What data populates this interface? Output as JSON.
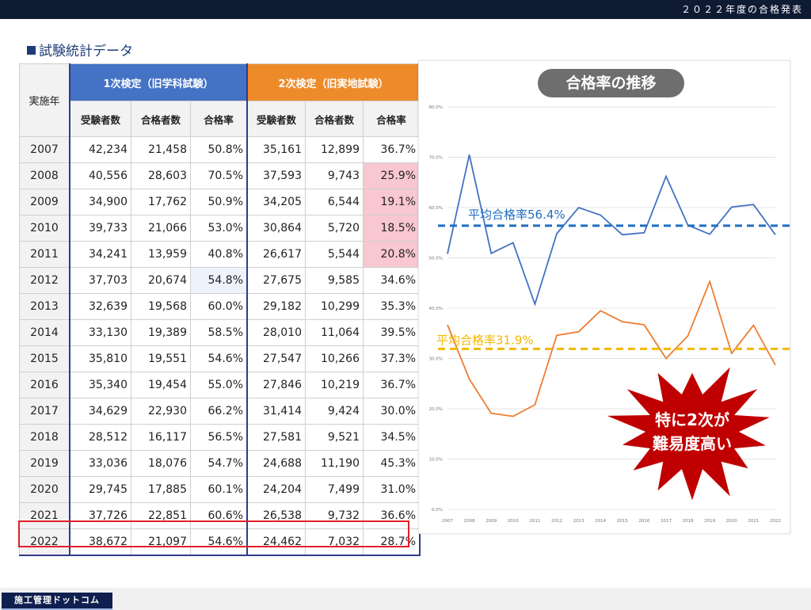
{
  "header": {
    "title": "２０２２年度の合格発表"
  },
  "section": {
    "title": "試験統計データ"
  },
  "table": {
    "year_header": "実施年",
    "group1": "1次検定（旧学科試験）",
    "group2": "2次検定（旧実地試験）",
    "sub_headers": [
      "受験者数",
      "合格者数",
      "合格率",
      "受験者数",
      "合格者数",
      "合格率"
    ],
    "rows": [
      {
        "year": "2007",
        "c1": "42,234",
        "c2": "21,458",
        "c3": "50.8%",
        "c4": "35,161",
        "c5": "12,899",
        "c6": "36.7%"
      },
      {
        "year": "2008",
        "c1": "40,556",
        "c2": "28,603",
        "c3": "70.5%",
        "c4": "37,593",
        "c5": "9,743",
        "c6": "25.9%"
      },
      {
        "year": "2009",
        "c1": "34,900",
        "c2": "17,762",
        "c3": "50.9%",
        "c4": "34,205",
        "c5": "6,544",
        "c6": "19.1%"
      },
      {
        "year": "2010",
        "c1": "39,733",
        "c2": "21,066",
        "c3": "53.0%",
        "c4": "30,864",
        "c5": "5,720",
        "c6": "18.5%"
      },
      {
        "year": "2011",
        "c1": "34,241",
        "c2": "13,959",
        "c3": "40.8%",
        "c4": "26,617",
        "c5": "5,544",
        "c6": "20.8%"
      },
      {
        "year": "2012",
        "c1": "37,703",
        "c2": "20,674",
        "c3": "54.8%",
        "c4": "27,675",
        "c5": "9,585",
        "c6": "34.6%"
      },
      {
        "year": "2013",
        "c1": "32,639",
        "c2": "19,568",
        "c3": "60.0%",
        "c4": "29,182",
        "c5": "10,299",
        "c6": "35.3%"
      },
      {
        "year": "2014",
        "c1": "33,130",
        "c2": "19,389",
        "c3": "58.5%",
        "c4": "28,010",
        "c5": "11,064",
        "c6": "39.5%"
      },
      {
        "year": "2015",
        "c1": "35,810",
        "c2": "19,551",
        "c3": "54.6%",
        "c4": "27,547",
        "c5": "10,266",
        "c6": "37.3%"
      },
      {
        "year": "2016",
        "c1": "35,340",
        "c2": "19,454",
        "c3": "55.0%",
        "c4": "27,846",
        "c5": "10,219",
        "c6": "36.7%"
      },
      {
        "year": "2017",
        "c1": "34,629",
        "c2": "22,930",
        "c3": "66.2%",
        "c4": "31,414",
        "c5": "9,424",
        "c6": "30.0%"
      },
      {
        "year": "2018",
        "c1": "28,512",
        "c2": "16,117",
        "c3": "56.5%",
        "c4": "27,581",
        "c5": "9,521",
        "c6": "34.5%"
      },
      {
        "year": "2019",
        "c1": "33,036",
        "c2": "18,076",
        "c3": "54.7%",
        "c4": "24,688",
        "c5": "11,190",
        "c6": "45.3%"
      },
      {
        "year": "2020",
        "c1": "29,745",
        "c2": "17,885",
        "c3": "60.1%",
        "c4": "24,204",
        "c5": "7,499",
        "c6": "31.0%"
      },
      {
        "year": "2021",
        "c1": "37,726",
        "c2": "22,851",
        "c3": "60.6%",
        "c4": "26,538",
        "c5": "9,732",
        "c6": "36.6%"
      },
      {
        "year": "2022",
        "c1": "38,672",
        "c2": "21,097",
        "c3": "54.6%",
        "c4": "24,462",
        "c5": "7,032",
        "c6": "28.7%"
      }
    ]
  },
  "chart_data": {
    "type": "line",
    "title": "合格率の推移",
    "x": [
      "2007",
      "2008",
      "2009",
      "2010",
      "2011",
      "2012",
      "2013",
      "2014",
      "2015",
      "2016",
      "2017",
      "2018",
      "2019",
      "2020",
      "2021",
      "2022"
    ],
    "series": [
      {
        "values": [
          50.8,
          70.5,
          50.9,
          53.0,
          40.8,
          54.8,
          60.0,
          58.5,
          54.6,
          55.0,
          66.2,
          56.5,
          54.7,
          60.1,
          60.6,
          54.6
        ],
        "color": "#4472c4"
      },
      {
        "values": [
          36.7,
          25.9,
          19.1,
          18.5,
          20.8,
          34.6,
          35.3,
          39.5,
          37.3,
          36.7,
          30.0,
          34.5,
          45.3,
          31.0,
          36.6,
          28.7
        ],
        "color": "#ed7d31"
      }
    ],
    "ylim": [
      0,
      80
    ],
    "yticks": [
      "0.0%",
      "10.0%",
      "20.0%",
      "30.0%",
      "40.0%",
      "50.0%",
      "60.0%",
      "70.0%",
      "80.0%"
    ],
    "reference_lines": [
      {
        "value": 56.4,
        "label": "平均合格率56.4%",
        "color": "#1f6fc0"
      },
      {
        "value": 31.9,
        "label": "平均合格率31.9%",
        "color": "#f4b800"
      }
    ],
    "callout": {
      "line1": "特に2次が",
      "line2": "難易度高い",
      "color": "#c00000"
    }
  },
  "footer": {
    "logo_text": "施工管理ドットコム"
  },
  "colors": {
    "highlight": "#f8c7cf",
    "accent_blue": "#4472c4",
    "accent_orange": "#ed8b2b",
    "callout_red": "#c00000"
  }
}
